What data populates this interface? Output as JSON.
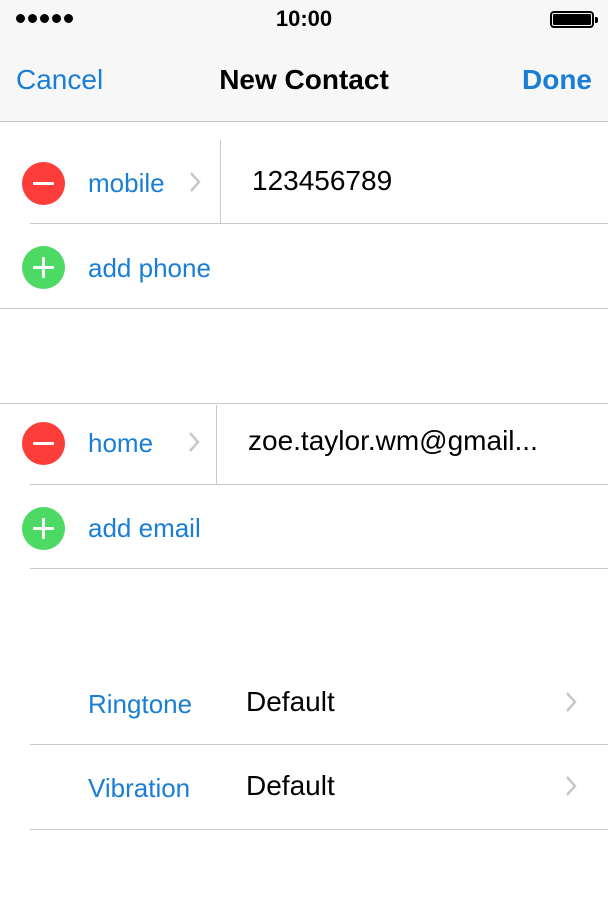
{
  "status_bar": {
    "time": "10:00"
  },
  "nav": {
    "cancel_label": "Cancel",
    "title": "New Contact",
    "done_label": "Done"
  },
  "phone": {
    "type_label": "mobile",
    "number": "123456789",
    "add_label": "add phone"
  },
  "email": {
    "type_label": "home",
    "address": "zoe.taylor.wm@gmail...",
    "add_label": "add email"
  },
  "settings": [
    {
      "label": "Ringtone",
      "value": "Default"
    },
    {
      "label": "Vibration",
      "value": "Default"
    }
  ],
  "colors": {
    "accent": "#1a7ed6",
    "delete": "#fc3d39",
    "add": "#4cd964",
    "separator": "#c8c7cc"
  }
}
